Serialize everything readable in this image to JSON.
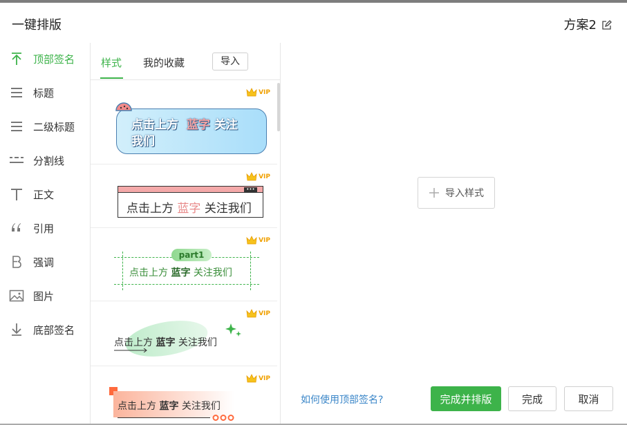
{
  "header": {
    "title": "一键排版",
    "scheme_label": "方案2",
    "edit_icon": "pencil-square-icon"
  },
  "sidebar": {
    "active_color": "#3db34a",
    "items": [
      {
        "label": "顶部签名",
        "icon": "arrow-up-bar-icon",
        "active": true
      },
      {
        "label": "标题",
        "icon": "hamburger-lines-icon",
        "active": false
      },
      {
        "label": "二级标题",
        "icon": "hamburger-lines-icon",
        "active": false
      },
      {
        "label": "分割线",
        "icon": "dashed-lines-icon",
        "active": false
      },
      {
        "label": "正文",
        "icon": "text-t-icon",
        "active": false
      },
      {
        "label": "引用",
        "icon": "quote-icon",
        "active": false
      },
      {
        "label": "强调",
        "icon": "bold-b-icon",
        "active": false
      },
      {
        "label": "图片",
        "icon": "image-icon",
        "active": false
      },
      {
        "label": "底部签名",
        "icon": "arrow-down-bar-icon",
        "active": false
      }
    ]
  },
  "style_panel": {
    "tabs": [
      {
        "label": "样式",
        "active": true
      },
      {
        "label": "我的收藏",
        "active": false
      }
    ],
    "import_label": "导入",
    "vip_label": "VIP",
    "cards": [
      {
        "parts": [
          "点击上方",
          "蓝字",
          "关注",
          "我们"
        ]
      },
      {
        "parts": [
          "点击上方",
          "蓝字",
          "关注我们"
        ]
      },
      {
        "badge": "part1",
        "parts": [
          "点击上方",
          "蓝字",
          "关注我们"
        ]
      },
      {
        "parts": [
          "点击上方",
          "蓝字",
          "关注我们"
        ]
      },
      {
        "parts": [
          "点击上方",
          "蓝字",
          "关注我们"
        ]
      }
    ]
  },
  "preview": {
    "import_style_label": "导入样式",
    "help_link": "如何使用顶部签名?",
    "buttons": {
      "apply": "完成并排版",
      "done": "完成",
      "cancel": "取消"
    }
  },
  "colors": {
    "accent": "#3db34a",
    "link": "#3a86c8",
    "vip": "#f0a000"
  }
}
